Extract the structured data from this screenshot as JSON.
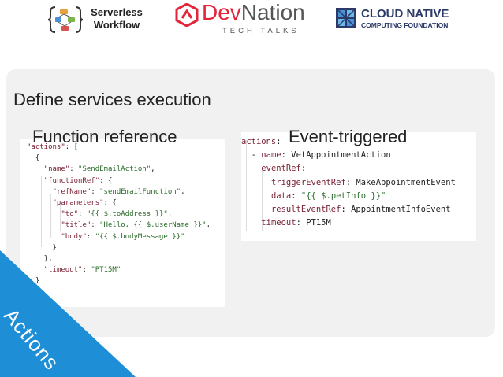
{
  "header": {
    "serverless_line1": "Serverless",
    "serverless_line2": "Workflow",
    "devnation_dev": "Dev",
    "devnation_nation": "Nation",
    "devnation_sub": "TECH TALKS",
    "cncf_line1": "CLOUD NATIVE",
    "cncf_line2": "COMPUTING FOUNDATION"
  },
  "slide": {
    "title": "Define services execution",
    "function_label": "Function reference",
    "event_label": "Event-triggered",
    "ribbon_label": "Actions"
  },
  "colors": {
    "panel": "#f1f1f2",
    "ribbon": "#1e8ed6",
    "devnation_red": "#e3253c",
    "cncf_navy": "#2b3a67",
    "json_key": "#7a2135",
    "json_string": "#2a6b2a"
  },
  "code_left": [
    "\"actions\": [",
    "  {",
    "    \"name\": \"SendEmailAction\",",
    "    \"functionRef\": {",
    "      \"refName\": \"sendEmailFunction\",",
    "      \"parameters\": {",
    "        \"to\": \"{{ $.toAddress }}\",",
    "        \"title\": \"Hello, {{ $.userName }}\",",
    "        \"body\": \"{{ $.bodyMessage }}\"",
    "      }",
    "    },",
    "    \"timeout\": \"PT15M\"",
    "  }",
    "]"
  ],
  "code_right": [
    "actions:",
    "  - name: VetAppointmentAction",
    "    eventRef:",
    "      triggerEventRef: MakeAppointmentEvent",
    "      data: \"{{ $.petInfo }}\"",
    "      resultEventRef: AppointmentInfoEvent",
    "    timeout: PT15M"
  ]
}
